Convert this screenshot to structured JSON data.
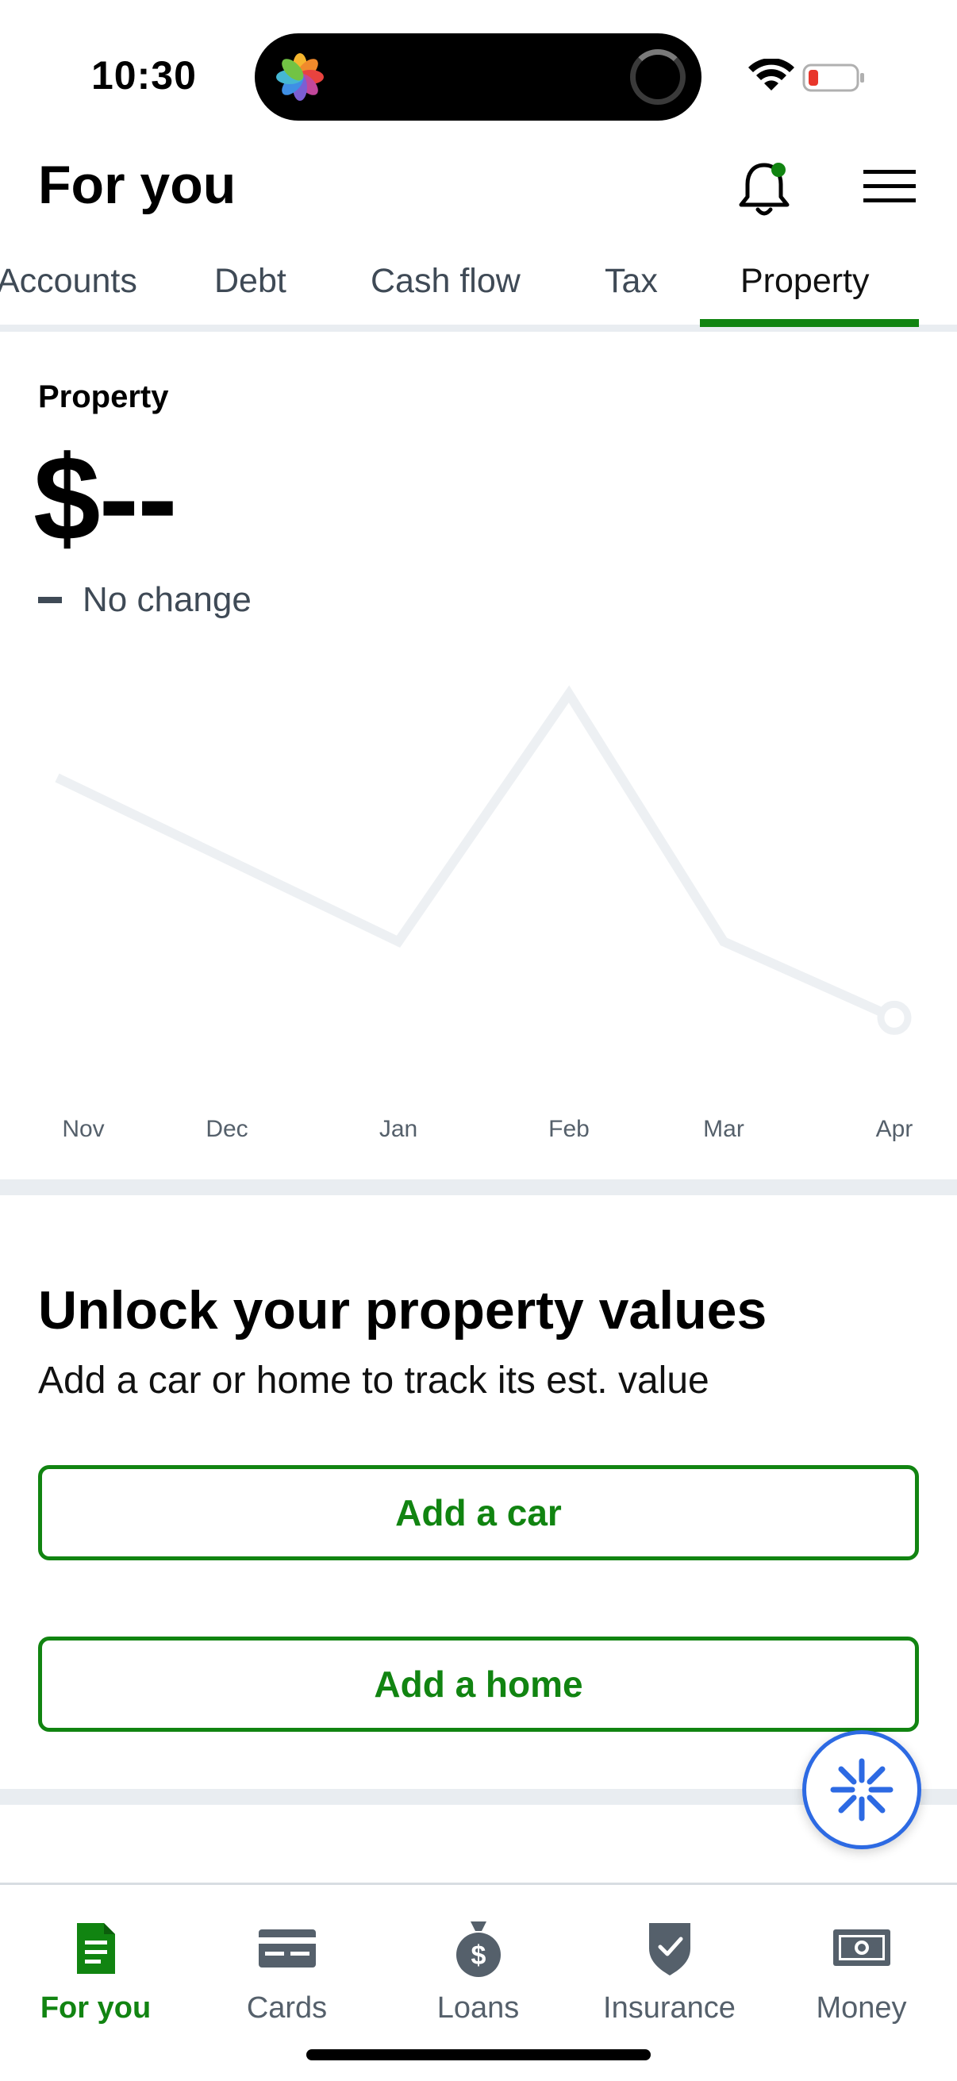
{
  "status_bar": {
    "time": "10:30",
    "icons": [
      "photos-icon",
      "wifi-icon",
      "battery-icon"
    ],
    "battery_color": "#e8362b"
  },
  "header": {
    "title": "For you",
    "icons": [
      "bell-icon",
      "menu-icon"
    ],
    "notification_dot_color": "#118411"
  },
  "tabs": [
    {
      "label": "Accounts",
      "active": false
    },
    {
      "label": "Debt",
      "active": false
    },
    {
      "label": "Cash flow",
      "active": false
    },
    {
      "label": "Tax",
      "active": false
    },
    {
      "label": "Property",
      "active": true
    }
  ],
  "property": {
    "label": "Property",
    "amount": "$--",
    "change_text": "No change"
  },
  "chart_data": {
    "type": "line",
    "categories": [
      "Nov",
      "Dec",
      "Jan",
      "Feb",
      "Mar",
      "Apr"
    ],
    "points": [
      {
        "x": "Nov",
        "y": 0.75
      },
      {
        "x": "Jan",
        "y": 0.32
      },
      {
        "x": "Feb",
        "y": 0.97
      },
      {
        "x": "Mar",
        "y": 0.32
      },
      {
        "x": "Apr",
        "y": 0.12
      }
    ],
    "line_color": "#edf0f3",
    "placeholder": true,
    "title": "",
    "xlabel": "",
    "ylabel": "",
    "grid": false
  },
  "unlock": {
    "title": "Unlock your property values",
    "subtitle": "Add a car or home to track its est. value",
    "add_car_label": "Add a car",
    "add_home_label": "Add a home"
  },
  "bottom_nav": [
    {
      "label": "For you",
      "icon": "document-icon",
      "active": true
    },
    {
      "label": "Cards",
      "icon": "card-icon",
      "active": false
    },
    {
      "label": "Loans",
      "icon": "money-bag-icon",
      "active": false
    },
    {
      "label": "Insurance",
      "icon": "shield-check-icon",
      "active": false
    },
    {
      "label": "Money",
      "icon": "cash-icon",
      "active": false
    }
  ],
  "colors": {
    "accent_green": "#118411",
    "assistant_blue": "#2d6ae3",
    "text_secondary": "#3f4a56"
  }
}
